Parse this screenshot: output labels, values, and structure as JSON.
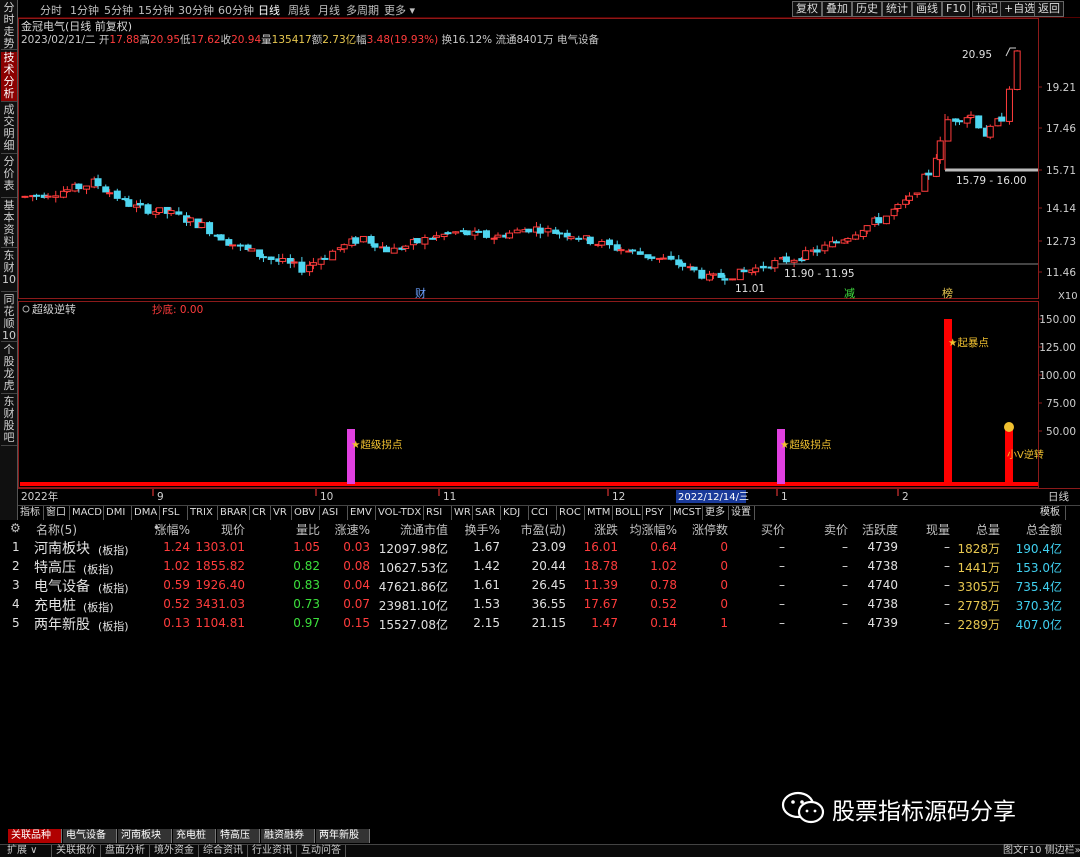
{
  "left_tabs": [
    {
      "label": "分时走势",
      "active": false
    },
    {
      "label": "技术分析",
      "active": true
    },
    {
      "label": "成交明细",
      "active": false
    },
    {
      "label": "分价表",
      "active": false
    },
    {
      "label": "基本资料",
      "active": false
    },
    {
      "label": "东财10",
      "active": false
    },
    {
      "label": "同花顺10",
      "active": false
    },
    {
      "label": "个股龙虎",
      "active": false
    },
    {
      "label": "东财股吧",
      "active": false
    }
  ],
  "periods": [
    "分时",
    "1分钟",
    "5分钟",
    "15分钟",
    "30分钟",
    "60分钟",
    "日线",
    "周线",
    "月线",
    "多周期",
    "更多 ▾"
  ],
  "active_period": "日线",
  "right_buttons": [
    "复权",
    "叠加",
    "历史",
    "统计",
    "画线",
    "F10",
    "标记",
    "+自选",
    "返回"
  ],
  "stock": {
    "title": "金冠电气(日线 前复权)",
    "date": "2023/02/21/二",
    "open_label": "开",
    "open": "17.88",
    "high_label": "高",
    "high": "20.95",
    "low_label": "低",
    "low": "17.62",
    "close_label": "收",
    "close": "20.94",
    "volume_label": "量",
    "volume": "135417",
    "amount_label": "额",
    "amount": "2.73亿",
    "change_label": "幅",
    "change": "3.48(19.93%)",
    "turnover": "换16.12%",
    "float": "流通8401万",
    "sector": "电气设备"
  },
  "price_axis": [
    "19.21",
    "17.46",
    "15.71",
    "14.14",
    "12.73",
    "11.46"
  ],
  "price_annotations": {
    "high_mark": "20.95",
    "range_upper": "15.79 - 16.00",
    "range_mid": "11.90 - 11.95",
    "low_mark": "11.01"
  },
  "event_markers": {
    "cai": "财",
    "jian": "减",
    "ju": "榜"
  },
  "x10_label": "X10",
  "indicator": {
    "name": "超级逆转",
    "param_label": "抄底: 0.00",
    "axis": [
      "150.00",
      "125.00",
      "100.00",
      "75.00",
      "50.00"
    ],
    "signals": [
      "★超级拐点",
      "★超级拐点",
      "★起暴点",
      "小V逆转"
    ]
  },
  "time_axis": {
    "labels": [
      "2022年",
      "9",
      "10",
      "11",
      "12",
      "2022/12/14/三",
      "1",
      "2"
    ],
    "period_label": "日线"
  },
  "indicator_tabs": [
    "指标",
    "窗口",
    "MACD",
    "DMI",
    "DMA",
    "FSL",
    "TRIX",
    "BRAR",
    "CR",
    "VR",
    "OBV",
    "ASI",
    "EMV",
    "VOL-TDX",
    "RSI",
    "WR",
    "SAR",
    "KDJ",
    "CCI",
    "ROC",
    "MTM",
    "BOLL",
    "PSY",
    "MCST",
    "更多",
    "设置"
  ],
  "template_label": "模板",
  "table": {
    "headers": [
      "名称(5)",
      "•",
      "涨幅%",
      "现价",
      "量比",
      "涨速%",
      "流通市值",
      "换手%",
      "市盈(动)",
      "涨跌",
      "均涨幅%",
      "涨停数",
      "买价",
      "卖价",
      "活跃度",
      "现量",
      "总量",
      "总金额"
    ],
    "rows": [
      {
        "idx": "1",
        "name": "河南板块",
        "tag": "(板指)",
        "chg": "1.24",
        "price": "1303.01",
        "vr": "1.05",
        "spd": "0.03",
        "mcap": "12097.98亿",
        "turn": "1.67",
        "pe": "23.09",
        "diff": "16.01",
        "avg": "0.64",
        "lim": "0",
        "bid": "–",
        "ask": "–",
        "act": "4739",
        "curvol": "–",
        "vol": "1828万",
        "amt": "190.4亿",
        "vr_up": true
      },
      {
        "idx": "2",
        "name": "特高压",
        "tag": "(板指)",
        "chg": "1.02",
        "price": "1855.82",
        "vr": "0.82",
        "spd": "0.08",
        "mcap": "10627.53亿",
        "turn": "1.42",
        "pe": "20.44",
        "diff": "18.78",
        "avg": "1.02",
        "lim": "0",
        "bid": "–",
        "ask": "–",
        "act": "4738",
        "curvol": "–",
        "vol": "1441万",
        "amt": "153.0亿",
        "vr_up": false
      },
      {
        "idx": "3",
        "name": "电气设备",
        "tag": "(板指)",
        "chg": "0.59",
        "price": "1926.40",
        "vr": "0.83",
        "spd": "0.04",
        "mcap": "47621.86亿",
        "turn": "1.61",
        "pe": "26.45",
        "diff": "11.39",
        "avg": "0.78",
        "lim": "0",
        "bid": "–",
        "ask": "–",
        "act": "4740",
        "curvol": "–",
        "vol": "3305万",
        "amt": "735.4亿",
        "vr_up": false
      },
      {
        "idx": "4",
        "name": "充电桩",
        "tag": "(板指)",
        "chg": "0.52",
        "price": "3431.03",
        "vr": "0.73",
        "spd": "0.07",
        "mcap": "23981.10亿",
        "turn": "1.53",
        "pe": "36.55",
        "diff": "17.67",
        "avg": "0.52",
        "lim": "0",
        "bid": "–",
        "ask": "–",
        "act": "4738",
        "curvol": "–",
        "vol": "2778万",
        "amt": "370.3亿",
        "vr_up": false
      },
      {
        "idx": "5",
        "name": "两年新股",
        "tag": "(板指)",
        "chg": "0.13",
        "price": "1104.81",
        "vr": "0.97",
        "spd": "0.15",
        "mcap": "15527.08亿",
        "turn": "2.15",
        "pe": "21.15",
        "diff": "1.47",
        "avg": "0.14",
        "lim": "1",
        "bid": "–",
        "ask": "–",
        "act": "4739",
        "curvol": "–",
        "vol": "2289万",
        "amt": "407.0亿",
        "vr_up": false
      }
    ]
  },
  "bottom_tabs": [
    "关联品种",
    "电气设备",
    "河南板块",
    "充电桩",
    "特高压",
    "融资融券",
    "两年新股"
  ],
  "status_items": [
    "扩展 ∨",
    "关联报价",
    "盘面分析",
    "境外资金",
    "综合资讯",
    "行业资讯",
    "互动问答"
  ],
  "status_right": "图文F10  侧边栏»",
  "watermark": "股票指标源码分享",
  "colors": {
    "up": "#ff3c3c",
    "down": "#4fd6f0",
    "signal_pink": "#e040e0",
    "signal_red": "#ff0000",
    "gold": "#f0c030"
  }
}
